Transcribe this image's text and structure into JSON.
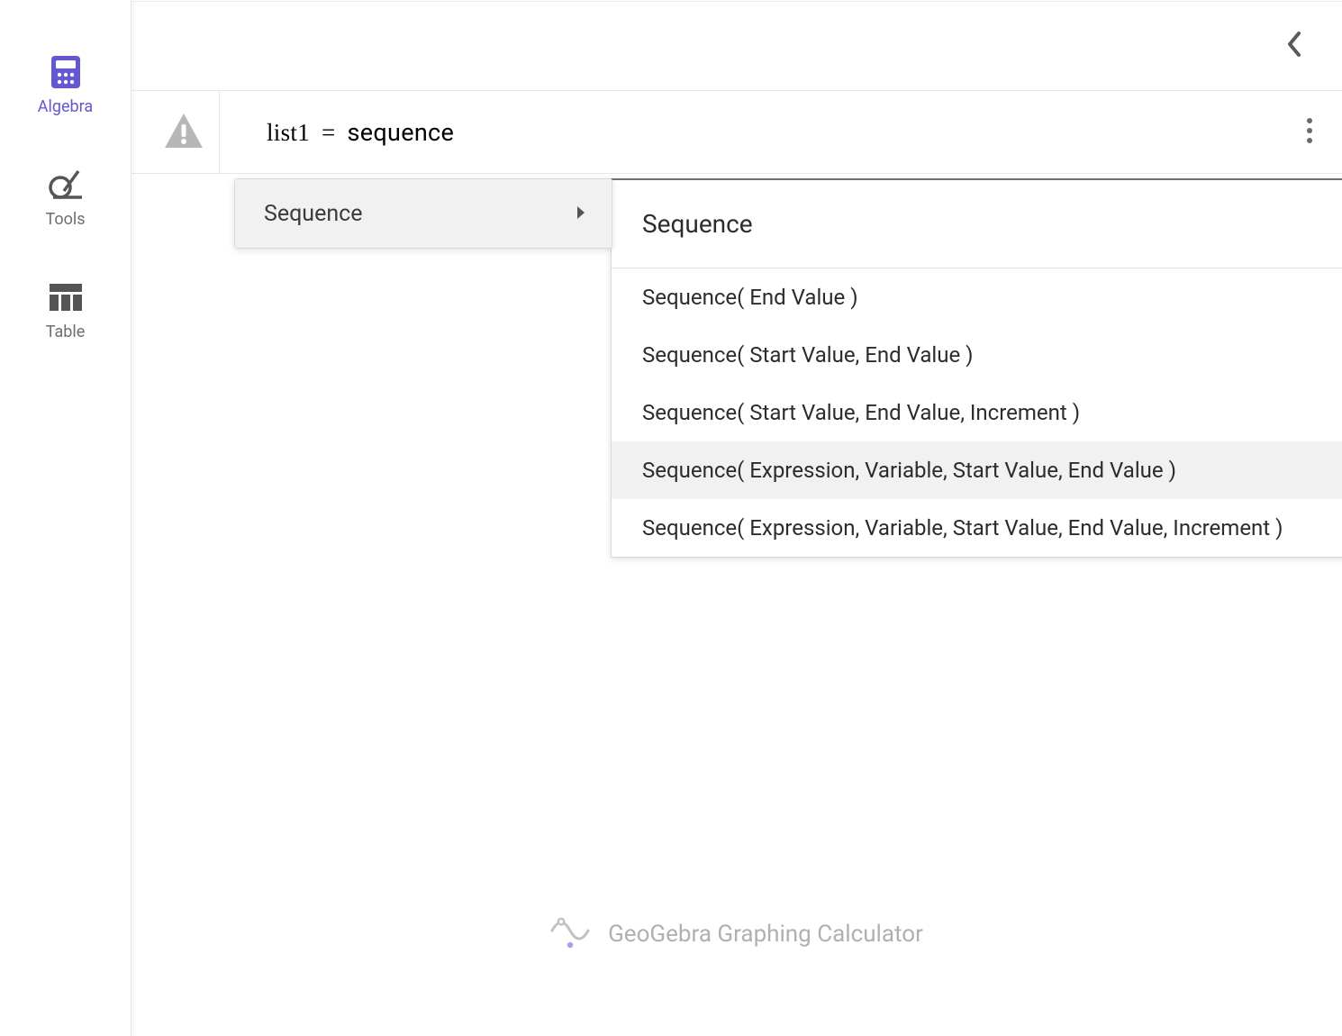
{
  "sidebar": {
    "items": [
      {
        "label": "Algebra"
      },
      {
        "label": "Tools"
      },
      {
        "label": "Table"
      }
    ]
  },
  "row": {
    "variable": "list1",
    "equals": "=",
    "value": "sequence"
  },
  "autocomplete": {
    "primary": "Sequence",
    "header": "Sequence",
    "options": [
      "Sequence( End Value )",
      "Sequence( Start Value, End Value )",
      "Sequence( Start Value, End Value, Increment )",
      "Sequence( Expression, Variable, Start Value, End Value )",
      "Sequence( Expression, Variable, Start Value, End Value, Increment )"
    ],
    "highlighted_index": 3
  },
  "branding": "GeoGebra Graphing Calculator"
}
